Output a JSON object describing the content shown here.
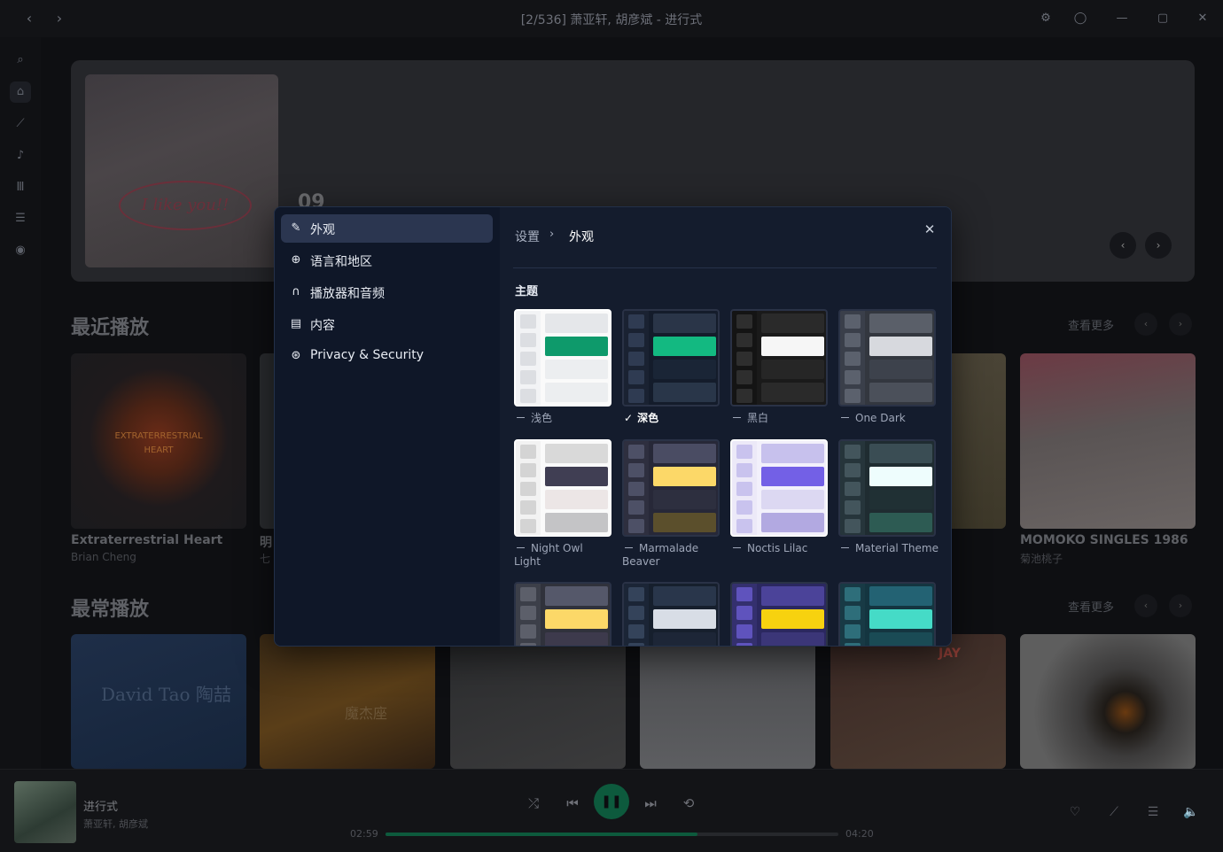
{
  "window": {
    "title": "[2/536] 萧亚轩, 胡彦斌 - 进行式",
    "back_icon": "‹",
    "forward_icon": "›",
    "settings_icon": "⚙",
    "user_icon": "◯",
    "minimize_icon": "—",
    "maximize_icon": "▢",
    "close_icon": "✕"
  },
  "rail": {
    "icons": [
      "⌕",
      "⌂",
      "⟋",
      "♪",
      "Ⅲ",
      "☰",
      "◉"
    ]
  },
  "hero": {
    "cover_text": "I like you!!",
    "number": "09",
    "prev": "‹",
    "next": "›"
  },
  "recent": {
    "title": "最近播放",
    "more": "查看更多",
    "prev": "‹",
    "next": "›",
    "cards": [
      {
        "title": "Extraterrestrial Heart",
        "subtitle": "Brian Cheng",
        "art_text": "EXTRATERRESTRIAL HEART"
      },
      {
        "title": "明",
        "subtitle": "七"
      },
      {
        "title": "MOMOKO SINGLES 1986",
        "subtitle": "菊池桃子"
      }
    ]
  },
  "frequent": {
    "title": "最常播放",
    "more": "查看更多",
    "prev": "‹",
    "next": "›",
    "cards": [
      {
        "art_text": "David Tao 陶喆"
      },
      {
        "art_text": "魔杰座"
      },
      {
        "art_text": ""
      },
      {
        "art_text": ""
      },
      {
        "art_text": "JAY"
      },
      {
        "art_text": ""
      }
    ]
  },
  "player": {
    "song": "进行式",
    "artist": "萧亚轩, 胡彦斌",
    "elapsed": "02:59",
    "duration": "04:20",
    "progress": 0.688,
    "controls": {
      "shuffle": "⤮",
      "prev": "⏮",
      "play": "❚❚",
      "next": "⏭",
      "repeat": "⟲"
    },
    "right": {
      "like": "♡",
      "tool": "⟋",
      "queue": "☰",
      "volume": "🔈"
    }
  },
  "settings": {
    "nav": [
      {
        "icon": "✎",
        "label": "外观",
        "active": true
      },
      {
        "icon": "⊕",
        "label": "语言和地区"
      },
      {
        "icon": "∩",
        "label": "播放器和音频"
      },
      {
        "icon": "▤",
        "label": "内容"
      },
      {
        "icon": "⊛",
        "label": "Privacy & Security"
      }
    ],
    "breadcrumb_root": "设置",
    "breadcrumb_sep": "›",
    "breadcrumb_current": "外观",
    "close": "✕",
    "theme_group_label": "主题",
    "selected_check": "✓",
    "themes": [
      {
        "name": "浅色",
        "side": "#f2f3f5",
        "sq": "#dcdee2",
        "bars": [
          "#e5e7ea",
          "#0e9a6b",
          "#eceef0",
          "#eceef0"
        ],
        "bg": "#fafafa"
      },
      {
        "name": "深色",
        "selected": true,
        "side": "#1a2232",
        "sq": "#2f3b52",
        "bars": [
          "#2a3548",
          "#13b981",
          "#1a2536",
          "#293649"
        ],
        "bg": "#141c2b"
      },
      {
        "name": "黑白",
        "side": "#141414",
        "sq": "#2e2e2e",
        "bars": [
          "#2a2a2a",
          "#f6f6f6",
          "#262626",
          "#2a2a2a"
        ],
        "bg": "#1a1a1a"
      },
      {
        "name": "One Dark",
        "side": "#3a3f4a",
        "sq": "#5b616d",
        "bars": [
          "#5a5f69",
          "#d7d9de",
          "#3d424c",
          "#4b505a"
        ],
        "bg": "#33373f"
      },
      {
        "name": "Night Owl Light",
        "side": "#f2f2f2",
        "sq": "#d4d4d4",
        "bars": [
          "#d9d9d9",
          "#403e53",
          "#ece6e6",
          "#c4c4c6"
        ],
        "bg": "#fafafa"
      },
      {
        "name": "Marmalade Beaver",
        "side": "#2e2f3f",
        "sq": "#4d5066",
        "bars": [
          "#4a4c63",
          "#fcd868",
          "#2d2f3f",
          "#5b4f2c"
        ],
        "bg": "#272838"
      },
      {
        "name": "Noctis Lilac",
        "side": "#ece9f8",
        "sq": "#c9c3ee",
        "bars": [
          "#c7c1ed",
          "#7360e6",
          "#dcd8f2",
          "#b2a9e1"
        ],
        "bg": "#f2f0fb"
      },
      {
        "name": "Material Theme",
        "side": "#26353b",
        "sq": "#43555c",
        "bars": [
          "#3a4d54",
          "#eefdfd",
          "#203034",
          "#2d5b53"
        ],
        "bg": "#1f2c31"
      },
      {
        "name": "",
        "side": "#3c3f49",
        "sq": "#5c5f6a",
        "bars": [
          "#55586a",
          "#fcd868",
          "#3d3a4c",
          "#3d3a4c"
        ],
        "bg": "#30323c"
      },
      {
        "name": "",
        "side": "#1b2536",
        "sq": "#34435a",
        "bars": [
          "#29364b",
          "#d8dde6",
          "#1d2637",
          "#1d2637"
        ],
        "bg": "#161f2d"
      },
      {
        "name": "",
        "side": "#34306e",
        "sq": "#5f53bd",
        "bars": [
          "#4b4399",
          "#f7d20f",
          "#3b3678",
          "#3b3678"
        ],
        "bg": "#2b2860"
      },
      {
        "name": "",
        "side": "#183a45",
        "sq": "#2e6e7a",
        "bars": [
          "#236273",
          "#45dbc7",
          "#1a4b55",
          "#1a4b55"
        ],
        "bg": "#143540"
      }
    ]
  }
}
